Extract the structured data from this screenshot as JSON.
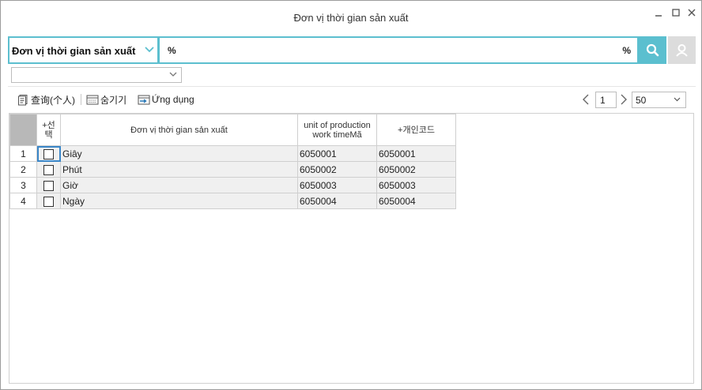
{
  "window": {
    "title": "Đơn vị thời gian sản xuất"
  },
  "search": {
    "field_label": "Đơn vị thời gian sản xuất",
    "value_left": "%",
    "value_right": "%"
  },
  "toolbar": {
    "query_label": "查询(个人)",
    "hide_label": "숨기기",
    "apply_label": "Ứng dụng"
  },
  "pager": {
    "page": "1",
    "page_size": "50"
  },
  "grid": {
    "columns": {
      "select": "+선\n택",
      "name": "Đơn vị thời gian sản xuất",
      "unit": "unit of production work timeMã",
      "personal_code": "+개인코드"
    },
    "rows": [
      {
        "num": "1",
        "name": "Giây",
        "unit": "6050001",
        "code": "6050001"
      },
      {
        "num": "2",
        "name": "Phút",
        "unit": "6050002",
        "code": "6050002"
      },
      {
        "num": "3",
        "name": "Giờ",
        "unit": "6050003",
        "code": "6050003"
      },
      {
        "num": "4",
        "name": "Ngày",
        "unit": "6050004",
        "code": "6050004"
      }
    ]
  },
  "colors": {
    "accent": "#5bbfcf",
    "reset_bg": "#dcdcdc",
    "focus": "#3a86c8"
  }
}
